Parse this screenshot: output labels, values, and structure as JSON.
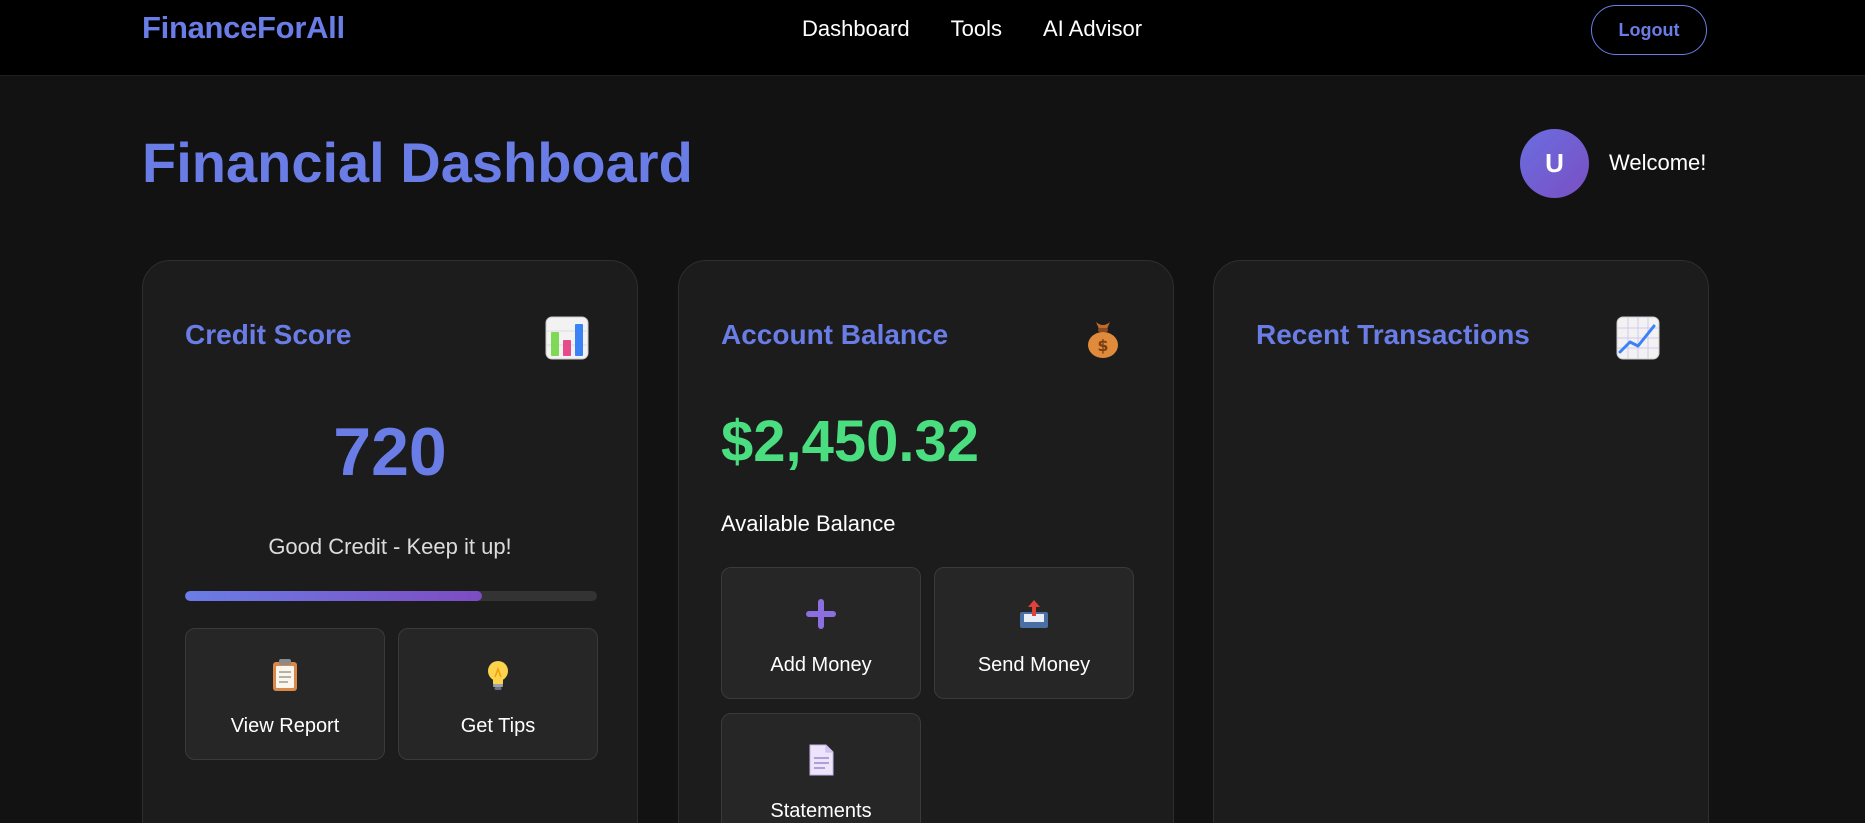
{
  "nav": {
    "brand": "FinanceForAll",
    "links": [
      "Dashboard",
      "Tools",
      "AI Advisor"
    ],
    "logout_label": "Logout"
  },
  "header": {
    "title": "Financial Dashboard",
    "avatar_initial": "U",
    "welcome": "Welcome!"
  },
  "credit_card": {
    "title": "Credit Score",
    "icon": "bar-chart-icon",
    "score": "720",
    "message": "Good Credit - Keep it up!",
    "progress_percent": 72,
    "actions": [
      {
        "label": "View Report",
        "icon": "clipboard-icon"
      },
      {
        "label": "Get Tips",
        "icon": "lightbulb-icon"
      }
    ]
  },
  "balance_card": {
    "title": "Account Balance",
    "icon": "money-bag-icon",
    "amount": "$2,450.32",
    "label": "Available Balance",
    "actions": [
      {
        "label": "Add Money",
        "icon": "plus-icon"
      },
      {
        "label": "Send Money",
        "icon": "outbox-icon"
      },
      {
        "label": "Statements",
        "icon": "document-icon"
      }
    ]
  },
  "transactions_card": {
    "title": "Recent Transactions",
    "icon": "trending-up-chart-icon"
  },
  "colors": {
    "accent": "#6a7de6",
    "balance_green": "#4ade80",
    "background": "#121212",
    "card": "#1c1c1c"
  }
}
